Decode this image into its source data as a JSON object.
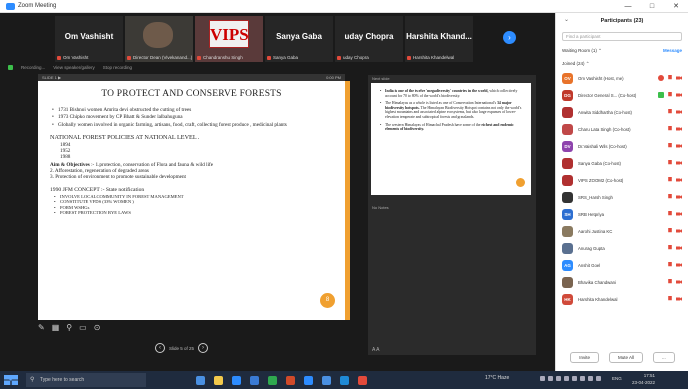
{
  "window": {
    "title": "Zoom Meeting"
  },
  "gallery": [
    {
      "name": "Om Vashisht",
      "label": "Om Vashisht",
      "kind": "name"
    },
    {
      "name": "",
      "label": "Director Dean (Vivekanand...)",
      "kind": "photo"
    },
    {
      "name": "",
      "label": "Chandranshu Singh",
      "kind": "vips"
    },
    {
      "name": "Sanya Gaba",
      "label": "Sanya Gaba",
      "kind": "name"
    },
    {
      "name": "uday Chopra",
      "label": "uday Chopra",
      "kind": "name"
    },
    {
      "name": "Harshita Khand...",
      "label": "Harshita Khandelwal",
      "kind": "name"
    }
  ],
  "vips_logo_text": "VIPS",
  "infobar": {
    "left": "Recording...",
    "mid": "View speaker/gallery",
    "right": "Stop recording"
  },
  "share": {
    "topbar_left": "SLIDE 1  ▶",
    "topbar_right": "0:00 PM",
    "title": "TO PROTECT AND CONSERVE FORESTS",
    "bullets": [
      "1731 Bishnoi women Amrita devi obstructed the cutting of trees",
      "1973 Chipko movement by CP Bhatt & Sunder lalbahuguna",
      "Globally women involved in organic farming, artisans, food, craft, collecting forest produce , medicinal plants"
    ],
    "policy_heading": "NATIONAL FOREST POLICIES AT NATIONAL LEVEL .",
    "policy_years": [
      "1894",
      "1952",
      "1988"
    ],
    "aims_label": "Aim & Objectives",
    "aims_text": ":- 1.protection, conservation of Flora and fauna & wild life",
    "aims_2": "2. Afforestation, regeneration of degraded areas",
    "aims_3": "3. Protection of environment to promote sustainable development",
    "jfm_heading": "1990 JFM CONCEPT :- State notification",
    "jfm_items": [
      "INVOLVE LOCALCOMMUNITY IN FOREST MANAGEMENT",
      "CONSTITUTE VFDS (33% WOMEN )",
      "FORM  WSHGs",
      "FOREST PROTECTION BYE LAWS"
    ],
    "page_number": "8"
  },
  "slide_nav": {
    "label": "Slide 5 of 25"
  },
  "notes": {
    "header": "Next slide",
    "bullets": [
      {
        "lead": "India is one of the twelve 'megadiversity' countries in the world,",
        "rest": " which collectively account for 70 to 80% of the world's biodiversity."
      },
      {
        "lead": "The Himalayas as a whole is listed as one of Conservation International's ",
        "bold": "34 major biodiversity hotspots.",
        "rest": " The Himalayan Biodiversity Hotspot contains not only the world's highest mountains and associated alpine ecosystems, but also large expanses of lower-elevation temperate and subtropical forests and grasslands."
      },
      {
        "lead": "The western Himalayas of Himachal Pradesh have some of the ",
        "bold": "richest and endemic elements of biodiversity.",
        "rest": ""
      }
    ],
    "notes_label": "No Notes",
    "footer": "A  A"
  },
  "participants": {
    "title": "Participants (23)",
    "search_placeholder": "Find a participant",
    "waiting_label": "Waiting Room (1)  ⌃",
    "message_label": "Message",
    "joined_label": "Joined (24)  ⌃",
    "list": [
      {
        "initials": "OV",
        "name": "Om Vashisht (Host, me)",
        "color": "#e8732a",
        "icons": [
          "heart",
          "mic",
          "cam"
        ]
      },
      {
        "initials": "DG",
        "name": "Director General S... (Co-host)",
        "color": "#c0392b",
        "icons": [
          "ok",
          "mic",
          "cam"
        ]
      },
      {
        "initials": "",
        "name": "Anwita Siddhartha (Co-host)",
        "color": "#b03030",
        "icons": [
          "mic",
          "cam"
        ]
      },
      {
        "initials": "",
        "name": "Charu Lata Singh (Co-host)",
        "color": "#c04848",
        "icons": [
          "mic",
          "cam"
        ]
      },
      {
        "initials": "DV",
        "name": "Dr.Vaishali Wils (Co-host)",
        "color": "#8e44ad",
        "icons": [
          "mic",
          "cam"
        ]
      },
      {
        "initials": "",
        "name": "Sanya Gaba (Co-host)",
        "color": "#b03030",
        "icons": [
          "mic",
          "cam"
        ]
      },
      {
        "initials": "",
        "name": "VIPS ZOOM2 (Co-host)",
        "color": "#b03030",
        "icons": [
          "mic",
          "cam"
        ]
      },
      {
        "initials": "",
        "name": "SRS_Harsh Singh",
        "color": "#333333",
        "icons": [
          "mic",
          "cam"
        ]
      },
      {
        "initials": "SH",
        "name": "SRB Hetpriya",
        "color": "#2d6fd1",
        "icons": [
          "mic",
          "cam"
        ]
      },
      {
        "initials": "",
        "name": "Aarohi Justina KC",
        "color": "#8a7a60",
        "icons": [
          "mic",
          "cam"
        ]
      },
      {
        "initials": "",
        "name": "Anurag Gupta",
        "color": "#5a7090",
        "icons": [
          "mic",
          "cam"
        ]
      },
      {
        "initials": "AG",
        "name": "Anshit Goel",
        "color": "#2d8cff",
        "icons": [
          "mic",
          "cam"
        ]
      },
      {
        "initials": "",
        "name": "Bhavika Chandwani",
        "color": "#7a6450",
        "icons": [
          "mic",
          "cam"
        ]
      },
      {
        "initials": "HK",
        "name": "Harshita Khandelwal",
        "color": "#d04a3a",
        "icons": [
          "mic",
          "cam"
        ]
      }
    ],
    "invite_label": "Invite",
    "mute_all_label": "Mute All",
    "more_label": "..."
  },
  "taskbar": {
    "search_placeholder": "Type here to search",
    "weather": "17°C Haze",
    "lang": "ENG",
    "time": "17:51",
    "date": "23-04-2022",
    "app_colors": [
      "#4a90e2",
      "#f2c94c",
      "#2d8cff",
      "#3a7bd5",
      "#2fa84f",
      "#d04a2a",
      "#2d8cff",
      "#4a90e2",
      "#1f8ad6",
      "#e24a3b"
    ]
  }
}
